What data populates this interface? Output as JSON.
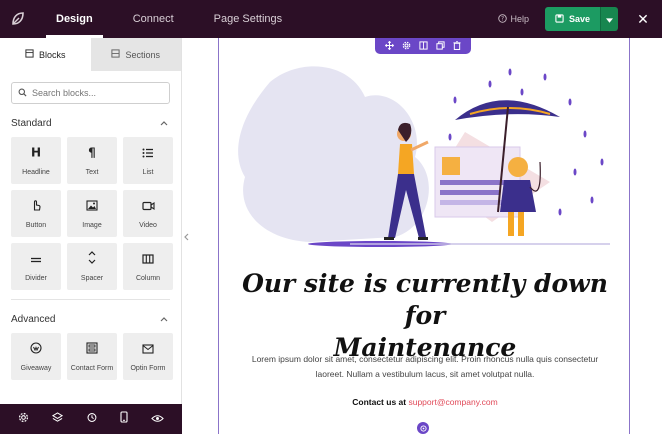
{
  "topbar": {
    "tabs": [
      {
        "label": "Design"
      },
      {
        "label": "Connect"
      },
      {
        "label": "Page Settings"
      }
    ],
    "help_label": "Help",
    "save_label": "Save",
    "close_glyph": "✕"
  },
  "sidebar": {
    "tabs": [
      {
        "label": "Blocks",
        "icon": "blocks-icon"
      },
      {
        "label": "Sections",
        "icon": "sections-icon"
      }
    ],
    "search": {
      "placeholder": "Search blocks..."
    },
    "standard": {
      "title": "Standard",
      "blocks": [
        {
          "label": "Headline",
          "icon": "headline-icon"
        },
        {
          "label": "Text",
          "icon": "paragraph-icon"
        },
        {
          "label": "List",
          "icon": "list-icon"
        },
        {
          "label": "Button",
          "icon": "pointer-icon"
        },
        {
          "label": "Image",
          "icon": "image-icon"
        },
        {
          "label": "Video",
          "icon": "video-icon"
        },
        {
          "label": "Divider",
          "icon": "divider-icon"
        },
        {
          "label": "Spacer",
          "icon": "spacer-icon"
        },
        {
          "label": "Column",
          "icon": "column-icon"
        }
      ]
    },
    "advanced": {
      "title": "Advanced",
      "blocks": [
        {
          "label": "Giveaway",
          "icon": "giveaway-icon"
        },
        {
          "label": "Contact Form",
          "icon": "contact-form-icon"
        },
        {
          "label": "Optin Form",
          "icon": "envelope-icon"
        }
      ]
    },
    "footer_icons": [
      "gear-icon",
      "layers-icon",
      "history-icon",
      "mobile-icon",
      "eye-icon"
    ]
  },
  "page": {
    "headline_line1": "Our site is currently down for",
    "headline_line2": "Maintenance",
    "body": "Lorem ipsum dolor sit amet, consectetur adipiscing elit. Proin rhoncus nulla quis consectetur laoreet. Nullam a vestibulum lacus, sit amet volutpat nulla.",
    "contact_label": "Contact us at",
    "contact_email": "support@company.com"
  },
  "colors": {
    "topbar": "#2c0f26",
    "save": "#1c9b62",
    "accent": "#6b47c7",
    "email": "#e14b5a"
  }
}
